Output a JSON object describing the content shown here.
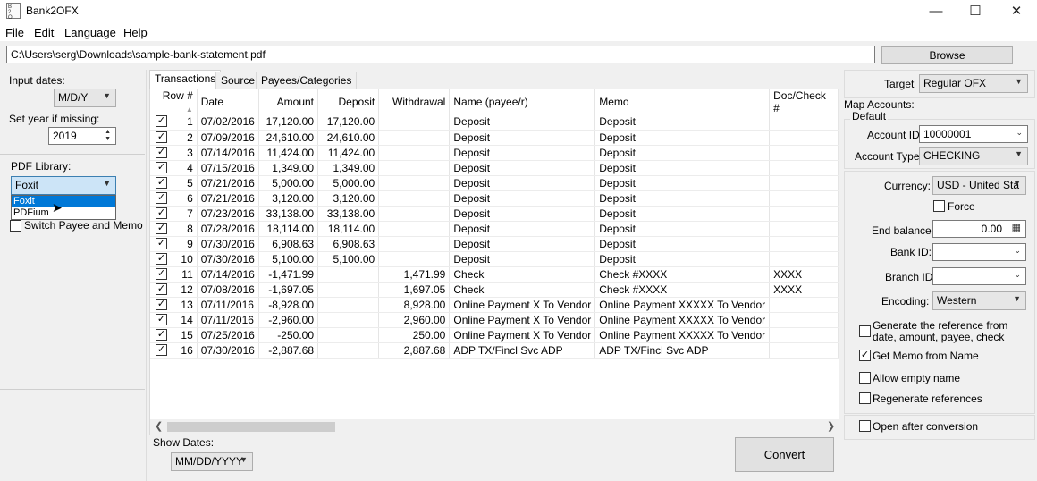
{
  "window": {
    "title": "Bank2OFX",
    "icon_text": "Bank\n2\nOFX",
    "minimize": "—",
    "maximize": "☐",
    "close": "✕"
  },
  "menu": [
    "File",
    "Edit",
    "Language",
    "Help"
  ],
  "file_path": "C:\\Users\\serg\\Downloads\\sample-bank-statement.pdf",
  "browse_label": "Browse",
  "left": {
    "input_dates_label": "Input dates:",
    "input_dates_value": "M/D/Y",
    "set_year_label": "Set year if missing:",
    "set_year_value": "2019",
    "pdf_library_label": "PDF Library:",
    "pdf_library_value": "Foxit",
    "pdf_library_options": [
      "Foxit",
      "PDFium"
    ],
    "switch_payee_label": "Switch Payee and Memo"
  },
  "tabs": [
    "Transactions",
    "Source",
    "Payees/Categories"
  ],
  "grid": {
    "headers": [
      "Row #",
      "Date",
      "Amount",
      "Deposit",
      "Withdrawal",
      "Name (payee/r)",
      "Memo",
      "Doc/Check #"
    ],
    "rows": [
      {
        "row": "1",
        "date": "07/02/2016",
        "amount": "17,120.00",
        "deposit": "17,120.00",
        "withdrawal": "",
        "name": "Deposit",
        "memo": "Deposit",
        "doc": ""
      },
      {
        "row": "2",
        "date": "07/09/2016",
        "amount": "24,610.00",
        "deposit": "24,610.00",
        "withdrawal": "",
        "name": "Deposit",
        "memo": "Deposit",
        "doc": ""
      },
      {
        "row": "3",
        "date": "07/14/2016",
        "amount": "11,424.00",
        "deposit": "11,424.00",
        "withdrawal": "",
        "name": "Deposit",
        "memo": "Deposit",
        "doc": ""
      },
      {
        "row": "4",
        "date": "07/15/2016",
        "amount": "1,349.00",
        "deposit": "1,349.00",
        "withdrawal": "",
        "name": "Deposit",
        "memo": "Deposit",
        "doc": ""
      },
      {
        "row": "5",
        "date": "07/21/2016",
        "amount": "5,000.00",
        "deposit": "5,000.00",
        "withdrawal": "",
        "name": "Deposit",
        "memo": "Deposit",
        "doc": ""
      },
      {
        "row": "6",
        "date": "07/21/2016",
        "amount": "3,120.00",
        "deposit": "3,120.00",
        "withdrawal": "",
        "name": "Deposit",
        "memo": "Deposit",
        "doc": ""
      },
      {
        "row": "7",
        "date": "07/23/2016",
        "amount": "33,138.00",
        "deposit": "33,138.00",
        "withdrawal": "",
        "name": "Deposit",
        "memo": "Deposit",
        "doc": ""
      },
      {
        "row": "8",
        "date": "07/28/2016",
        "amount": "18,114.00",
        "deposit": "18,114.00",
        "withdrawal": "",
        "name": "Deposit",
        "memo": "Deposit",
        "doc": ""
      },
      {
        "row": "9",
        "date": "07/30/2016",
        "amount": "6,908.63",
        "deposit": "6,908.63",
        "withdrawal": "",
        "name": "Deposit",
        "memo": "Deposit",
        "doc": ""
      },
      {
        "row": "10",
        "date": "07/30/2016",
        "amount": "5,100.00",
        "deposit": "5,100.00",
        "withdrawal": "",
        "name": "Deposit",
        "memo": "Deposit",
        "doc": ""
      },
      {
        "row": "11",
        "date": "07/14/2016",
        "amount": "-1,471.99",
        "deposit": "",
        "withdrawal": "1,471.99",
        "name": "Check",
        "memo": "Check #XXXX",
        "doc": "XXXX"
      },
      {
        "row": "12",
        "date": "07/08/2016",
        "amount": "-1,697.05",
        "deposit": "",
        "withdrawal": "1,697.05",
        "name": "Check",
        "memo": "Check #XXXX",
        "doc": "XXXX"
      },
      {
        "row": "13",
        "date": "07/11/2016",
        "amount": "-8,928.00",
        "deposit": "",
        "withdrawal": "8,928.00",
        "name": "Online Payment X To Vendor",
        "memo": "Online Payment XXXXX To Vendor",
        "doc": ""
      },
      {
        "row": "14",
        "date": "07/11/2016",
        "amount": "-2,960.00",
        "deposit": "",
        "withdrawal": "2,960.00",
        "name": "Online Payment X To Vendor",
        "memo": "Online Payment XXXXX To Vendor",
        "doc": ""
      },
      {
        "row": "15",
        "date": "07/25/2016",
        "amount": "-250.00",
        "deposit": "",
        "withdrawal": "250.00",
        "name": "Online Payment X To Vendor",
        "memo": "Online Payment XXXXX To Vendor",
        "doc": ""
      },
      {
        "row": "16",
        "date": "07/30/2016",
        "amount": "-2,887.68",
        "deposit": "",
        "withdrawal": "2,887.68",
        "name": "ADP TX/Fincl Svc ADP",
        "memo": "ADP TX/Fincl Svc ADP",
        "doc": ""
      }
    ]
  },
  "show_dates_label": "Show Dates:",
  "show_dates_value": "MM/DD/YYYY",
  "convert_label": "Convert",
  "right": {
    "target_label": "Target",
    "target_value": "Regular OFX",
    "map_accounts_label": "Map Accounts:",
    "default_label": "Default",
    "account_id_label": "Account ID:",
    "account_id_value": "10000001",
    "account_type_label": "Account Type:",
    "account_type_value": "CHECKING",
    "currency_label": "Currency:",
    "currency_value": "USD - United Sta",
    "force_label": "Force",
    "end_balance_label": "End balance:",
    "end_balance_value": "0.00",
    "bank_id_label": "Bank ID:",
    "branch_id_label": "Branch ID",
    "encoding_label": "Encoding:",
    "encoding_value": "Western",
    "gen_ref_label": "Generate the reference from date, amount, payee, check",
    "get_memo_label": "Get Memo from Name",
    "allow_empty_label": "Allow empty name",
    "regen_ref_label": "Regenerate references",
    "open_after_label": "Open after conversion"
  }
}
